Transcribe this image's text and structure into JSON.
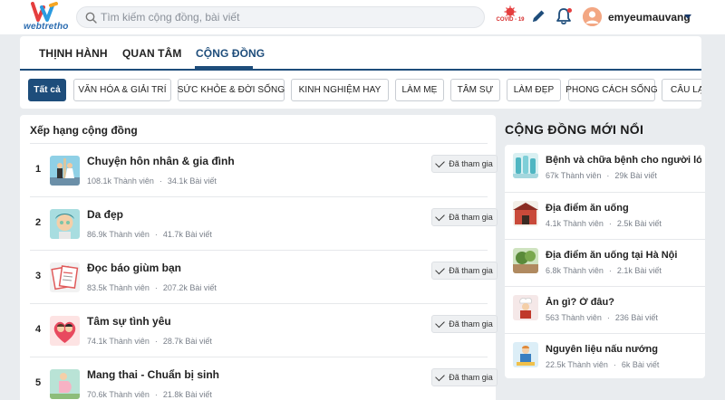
{
  "header": {
    "logo_text": "webtretho",
    "search": {
      "placeholder": "Tìm kiếm cộng đồng, bài viết"
    },
    "covid_badge": "COVID - 19",
    "username": "emyeumauvang"
  },
  "main_tabs": [
    {
      "label": "THỊNH HÀNH",
      "active": false
    },
    {
      "label": "QUAN TÂM",
      "active": false
    },
    {
      "label": "CỘNG ĐỒNG",
      "active": true
    }
  ],
  "categories": [
    {
      "label": "Tất cả",
      "active": true
    },
    {
      "label": "VĂN HÓA & GIẢI TRÍ",
      "active": false
    },
    {
      "label": "SỨC KHỎE & ĐỜI SỐNG",
      "active": false
    },
    {
      "label": "KINH NGHIỆM HAY",
      "active": false
    },
    {
      "label": "LÀM MẸ",
      "active": false
    },
    {
      "label": "TÂM SỰ",
      "active": false
    },
    {
      "label": "LÀM ĐẸP",
      "active": false
    },
    {
      "label": "PHONG CÁCH SỐNG",
      "active": false
    },
    {
      "label": "CÂU LẠ",
      "active": false
    }
  ],
  "ranking": {
    "title": "Xếp hạng cộng đồng",
    "items": [
      {
        "rank": "1",
        "name": "Chuyện hôn nhân & gia đình",
        "members": "108.1k Thành viên",
        "posts": "34.1k Bài viết",
        "button": "Đã tham gia"
      },
      {
        "rank": "2",
        "name": "Da đẹp",
        "members": "86.9k Thành viên",
        "posts": "41.7k Bài viết",
        "button": "Đã tham gia"
      },
      {
        "rank": "3",
        "name": "Đọc báo giùm bạn",
        "members": "83.5k Thành viên",
        "posts": "207.2k Bài viết",
        "button": "Đã tham gia"
      },
      {
        "rank": "4",
        "name": "Tâm sự tình yêu",
        "members": "74.1k Thành viên",
        "posts": "28.7k Bài viết",
        "button": "Đã tham gia"
      },
      {
        "rank": "5",
        "name": "Mang thai - Chuẩn bị sinh",
        "members": "70.6k Thành viên",
        "posts": "21.8k Bài viết",
        "button": "Đã tham gia"
      }
    ]
  },
  "new_communities": {
    "title": "CỘNG ĐỒNG MỚI NỔI",
    "items": [
      {
        "name": "Bệnh và chữa bệnh cho người lớn",
        "members": "67k Thành viên",
        "posts": "29k Bài viết"
      },
      {
        "name": "Địa điểm ăn uống",
        "members": "4.1k Thành viên",
        "posts": "2.5k Bài viết"
      },
      {
        "name": "Địa điểm ăn uống tại Hà Nội",
        "members": "6.8k Thành viên",
        "posts": "2.1k Bài viết"
      },
      {
        "name": "Ăn gì? Ở đâu?",
        "members": "563 Thành viên",
        "posts": "236 Bài viết"
      },
      {
        "name": "Nguyên liệu nấu nướng",
        "members": "22.5k Thành viên",
        "posts": "6k Bài viết"
      }
    ]
  },
  "colors": {
    "accent": "#1e4d7b",
    "background": "#e9ecef",
    "notification": "#e53e3e"
  }
}
